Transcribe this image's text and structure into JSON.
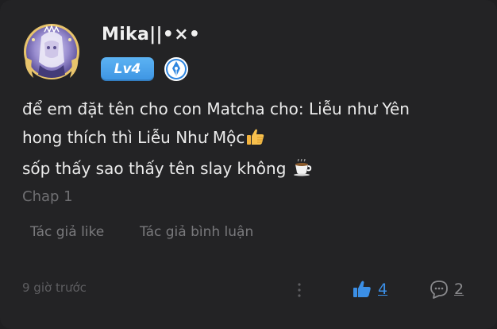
{
  "author": {
    "name": "Mika||•×•",
    "level": "Lv4",
    "avatar_icon": "anime-character-avatar-with-laurel-frame",
    "role_icon": "blue-pen-nib-badge-icon"
  },
  "comment": {
    "lines": [
      "để em đặt tên cho con Matcha cho: Liễu như Yên",
      "hong thích thì Liễu Như Mộc",
      "sốp thấy sao thấy tên slay không"
    ],
    "emoji_1": "thumbs-up-emoji",
    "emoji_2": "coffee-cup-emoji"
  },
  "chapter": "Chap 1",
  "tags": {
    "author_liked": "Tác giả like",
    "author_commented": "Tác giả bình luận"
  },
  "footer": {
    "time": "9 giờ trước",
    "like_count": "4",
    "reply_count": "2"
  },
  "colors": {
    "background": "#232325",
    "accent_blue": "#3b8fe6",
    "level_badge": "#4aa3ec",
    "muted_text": "#6f6f72"
  }
}
